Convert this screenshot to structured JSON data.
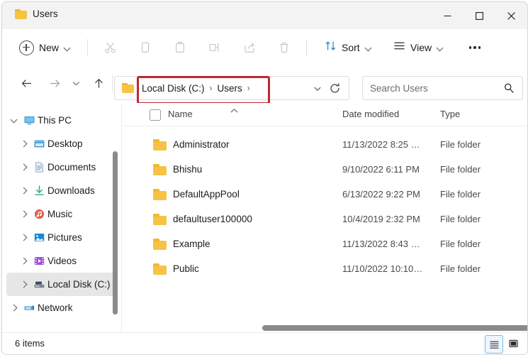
{
  "window": {
    "title": "Users",
    "icon": "folder-icon",
    "controls": {
      "minimize": "Minimize",
      "maximize": "Maximize",
      "close": "Close"
    }
  },
  "toolbar": {
    "new_label": "New",
    "new_icon": "plus-circle-icon",
    "actions": [
      {
        "name": "cut",
        "icon": "scissors-icon",
        "enabled": false
      },
      {
        "name": "copy",
        "icon": "copy-icon",
        "enabled": false
      },
      {
        "name": "paste",
        "icon": "clipboard-icon",
        "enabled": false
      },
      {
        "name": "rename",
        "icon": "rename-icon",
        "enabled": false
      },
      {
        "name": "share",
        "icon": "share-icon",
        "enabled": false
      },
      {
        "name": "delete",
        "icon": "trash-icon",
        "enabled": false
      }
    ],
    "sort_label": "Sort",
    "sort_icon": "sort-arrows-icon",
    "view_label": "View",
    "view_icon": "hamburger-icon",
    "overflow_label": "See more",
    "accent_color": "#1f7ec4"
  },
  "navigation": {
    "back": "Back",
    "forward": "Forward",
    "recent": "Recent locations",
    "up": "Up"
  },
  "address": {
    "folder_icon": "folder-icon",
    "crumbs": [
      "Local Disk (C:)",
      "Users"
    ],
    "separator": "›",
    "trailing_separator": "›",
    "dropdown": "Previous locations",
    "refresh": "Refresh",
    "highlight_color": "#c0282d"
  },
  "search": {
    "placeholder": "Search Users",
    "icon": "search-icon"
  },
  "sidebar": {
    "items": [
      {
        "label": "This PC",
        "icon": "monitor-icon",
        "level": 0,
        "expanded": true,
        "selected": false
      },
      {
        "label": "Desktop",
        "icon": "desktop-icon",
        "level": 1,
        "expanded": false,
        "selected": false
      },
      {
        "label": "Documents",
        "icon": "document-icon",
        "level": 1,
        "expanded": false,
        "selected": false
      },
      {
        "label": "Downloads",
        "icon": "download-icon",
        "level": 1,
        "expanded": false,
        "selected": false
      },
      {
        "label": "Music",
        "icon": "music-icon",
        "level": 1,
        "expanded": false,
        "selected": false
      },
      {
        "label": "Pictures",
        "icon": "pictures-icon",
        "level": 1,
        "expanded": false,
        "selected": false
      },
      {
        "label": "Videos",
        "icon": "videos-icon",
        "level": 1,
        "expanded": false,
        "selected": false
      },
      {
        "label": "Local Disk (C:)",
        "icon": "drive-icon",
        "level": 1,
        "expanded": false,
        "selected": true
      },
      {
        "label": "Network",
        "icon": "network-icon",
        "level": 0,
        "expanded": false,
        "selected": false
      }
    ]
  },
  "file_list": {
    "columns": [
      "Name",
      "Date modified",
      "Type"
    ],
    "sort_column": "Name",
    "sort_direction": "ascending",
    "select_all_checked": false,
    "rows": [
      {
        "name": "Administrator",
        "date": "11/13/2022 8:25 …",
        "type": "File folder",
        "icon": "folder-icon"
      },
      {
        "name": "Bhishu",
        "date": "9/10/2022 6:11 PM",
        "type": "File folder",
        "icon": "folder-icon"
      },
      {
        "name": "DefaultAppPool",
        "date": "6/13/2022 9:22 PM",
        "type": "File folder",
        "icon": "folder-icon"
      },
      {
        "name": "defaultuser100000",
        "date": "10/4/2019 2:32 PM",
        "type": "File folder",
        "icon": "folder-icon"
      },
      {
        "name": "Example",
        "date": "11/13/2022 8:43 …",
        "type": "File folder",
        "icon": "folder-icon"
      },
      {
        "name": "Public",
        "date": "11/10/2022 10:10…",
        "type": "File folder",
        "icon": "folder-icon"
      }
    ]
  },
  "status_bar": {
    "item_count": "6 items",
    "details_view": "Details view",
    "large_icons_view": "Large icons view"
  }
}
